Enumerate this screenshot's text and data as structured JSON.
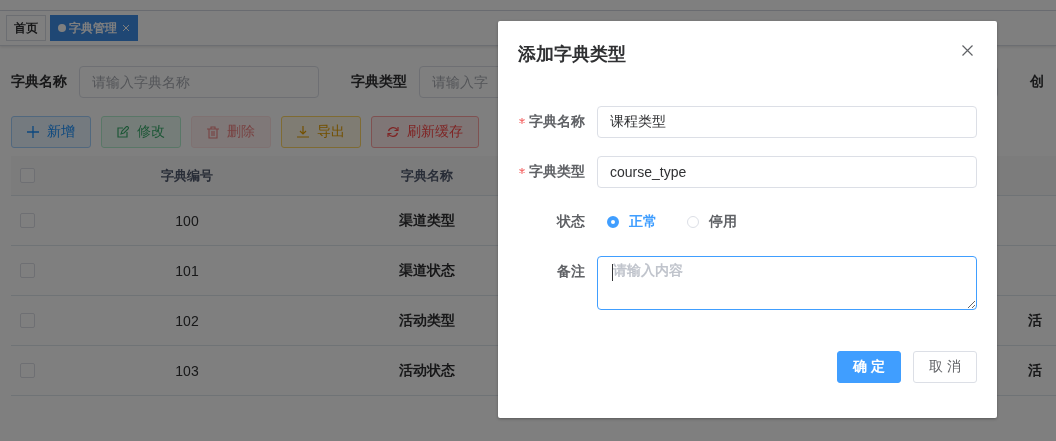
{
  "tags": [
    {
      "label": "首页",
      "selected": false,
      "closable": false
    },
    {
      "label": "字典管理",
      "selected": true,
      "closable": true
    }
  ],
  "search_form": [
    {
      "label": "字典名称",
      "placeholder": "请输入字典名称"
    },
    {
      "label": "字典类型",
      "placeholder": "请输入字"
    },
    {
      "label": "创"
    }
  ],
  "toolbar": [
    {
      "label": "新增",
      "kind": "add",
      "disabled": false
    },
    {
      "label": "修改",
      "kind": "edit",
      "disabled": true
    },
    {
      "label": "删除",
      "kind": "delete",
      "disabled": true
    },
    {
      "label": "导出",
      "kind": "export",
      "disabled": false
    },
    {
      "label": "刷新缓存",
      "kind": "refresh",
      "disabled": false
    }
  ],
  "table": {
    "all_selected": false,
    "columns": [
      "字典编号",
      "字典名称"
    ],
    "rows": [
      {
        "selected": false,
        "cells": [
          "100",
          "渠道类型"
        ]
      },
      {
        "selected": false,
        "cells": [
          "101",
          "渠道状态"
        ]
      },
      {
        "selected": false,
        "cells": [
          "102",
          "活动类型"
        ],
        "column_3": "活"
      },
      {
        "selected": false,
        "cells": [
          "103",
          "活动状态"
        ],
        "column_3": "活"
      }
    ]
  },
  "dialog": {
    "title": "添加字典类型",
    "fields": [
      {
        "kind": "input",
        "label": "字典名称",
        "required": true,
        "value": "课程类型"
      },
      {
        "kind": "input",
        "label": "字典类型",
        "required": true,
        "value": "course_type"
      },
      {
        "kind": "radio",
        "label": "状态",
        "options": [
          {
            "label": "正常",
            "selected": true
          },
          {
            "label": "停用",
            "selected": false
          }
        ]
      },
      {
        "kind": "textarea",
        "label": "备注",
        "placeholder": "请输入内容",
        "focused": true
      }
    ],
    "buttons": [
      {
        "label": "确 定",
        "kind": "primary"
      },
      {
        "label": "取 消",
        "kind": "default"
      }
    ]
  }
}
